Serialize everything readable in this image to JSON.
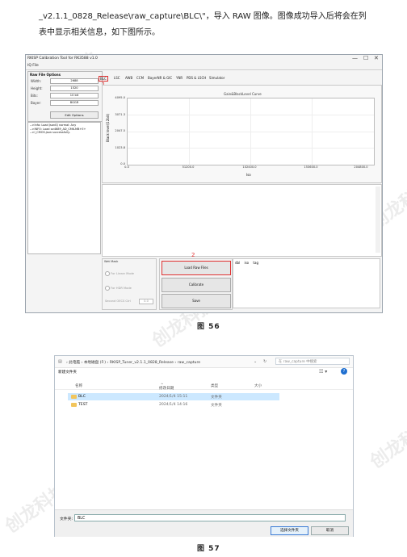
{
  "doc": {
    "line1": "_v2.1.1_0828_Release\\raw_capture\\BLC\\\"，导入 RAW 图像。图像成功导入后将会在列",
    "line2": "表中显示相关信息，如下图所示。",
    "fig56_caption": "图  56",
    "fig57_caption": "图  57",
    "watermark": "创龙科技"
  },
  "fig56": {
    "title": "RKISP Calibration Tool for RK3588 v1.0",
    "window_controls": [
      "—",
      "☐",
      "✕"
    ],
    "menu": "IQ File",
    "left_panel": {
      "heading": "Raw File Options",
      "fields": [
        {
          "label": "Width:",
          "value": "2688"
        },
        {
          "label": "Height:",
          "value": "1520"
        },
        {
          "label": "Bits:",
          "value": "10 bit"
        },
        {
          "label": "Bayer:",
          "value": "BGGR"
        }
      ],
      "button": "Edit Options"
    },
    "log_lines": [
      "-->Info: Load JsonIQ normal: Any",
      "-->INFO: Load ov4689_AD_CMK-MB+E+",
      "-->I_CMOS.json successfully."
    ],
    "tabs": [
      "BLC",
      "LSC",
      "AWB",
      "CCM",
      "BayerNR & GIC",
      "YNR",
      "PDS & LSCH",
      "Simulator"
    ],
    "tab_marker": "1",
    "chart": {
      "title": "Gain&BlackLevel Curve",
      "xlabel": "Iso",
      "ylabel": "Black level(12bit)",
      "yticks": [
        "4095.0",
        "3071.3",
        "2047.5",
        "1023.8",
        "0.0"
      ],
      "xticks": [
        "0.0",
        "51200.0",
        "102400.0",
        "153600.0",
        "204800.0"
      ]
    },
    "bottom": {
      "wb_label": "Wet Mask",
      "for_linear": "For Linear Mode",
      "for_hdr": "For HDR Mode",
      "second_label": "Second OECS Ctrl",
      "second_value": "0.0",
      "load_button": "Load Raw Files",
      "calibrate_button": "Calibrate",
      "save_button": "Save",
      "load_marker": "2",
      "log_cols": [
        "dbl",
        "iso",
        "tag"
      ]
    }
  },
  "fig57": {
    "breadcrumbs": "›  此电脑  ›  本地磁盘 (F:)  ›  RKISP_Tuner_v2.1.1_0828_Release  ›  raw_capture",
    "search_placeholder": "在 raw_capture 中搜索",
    "toolbar_label": "新建文件夹",
    "columns": [
      "名称",
      "修改日期",
      "类型",
      "大小"
    ],
    "rows": [
      {
        "name": "BLC",
        "date": "2024/1/4 15:11",
        "type": "文件夹",
        "selected": true
      },
      {
        "name": "TEST",
        "date": "2024/1/4 14:16",
        "type": "文件夹",
        "selected": false
      }
    ],
    "filename_label": "文件夹:",
    "filename_value": "BLC",
    "select_button": "选择文件夹",
    "cancel_button": "取消"
  }
}
